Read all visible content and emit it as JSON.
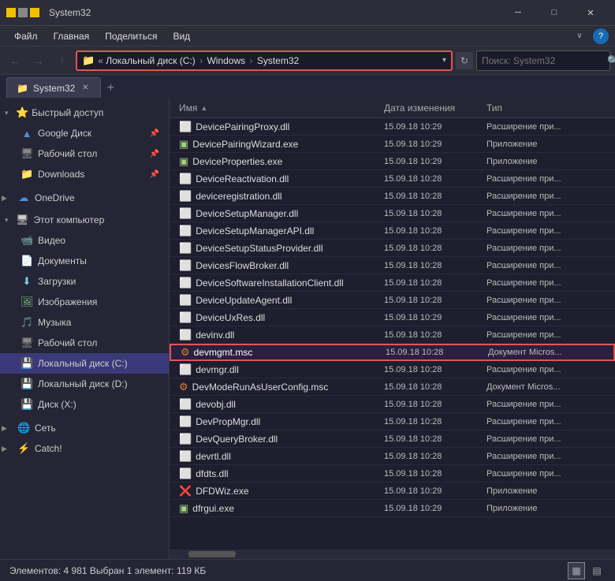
{
  "titleBar": {
    "title": "System32",
    "minimize": "─",
    "maximize": "□",
    "close": "✕"
  },
  "menuBar": {
    "items": [
      "Файл",
      "Главная",
      "Поделиться",
      "Вид"
    ]
  },
  "toolbar": {
    "backDisabled": true,
    "forwardDisabled": true,
    "upLabel": "↑",
    "addressIcon": "📁",
    "addressParts": [
      "« Локальный диск (C:)",
      "Windows",
      "System32"
    ],
    "refreshLabel": "↻",
    "searchPlaceholder": "Поиск: System32",
    "searchIcon": "🔍"
  },
  "tabs": {
    "items": [
      {
        "label": "System32",
        "icon": "📁"
      }
    ],
    "addLabel": "+"
  },
  "sidebar": {
    "quickAccess": {
      "label": "Быстрый доступ",
      "icon": "⭐",
      "items": [
        {
          "label": "Google Диск",
          "icon": "🔷",
          "pinned": true
        },
        {
          "label": "Рабочий стол",
          "icon": "🖥",
          "pinned": true
        },
        {
          "label": "Downloads",
          "icon": "📁",
          "pinned": true
        }
      ]
    },
    "onedrive": {
      "label": "OneDrive",
      "icon": "☁"
    },
    "thisPC": {
      "label": "Этот компьютер",
      "icon": "💻",
      "items": [
        {
          "label": "Видео",
          "icon": "🎬"
        },
        {
          "label": "Документы",
          "icon": "📄"
        },
        {
          "label": "Загрузки",
          "icon": "⬇"
        },
        {
          "label": "Изображения",
          "icon": "🖼"
        },
        {
          "label": "Музыка",
          "icon": "🎵"
        },
        {
          "label": "Рабочий стол",
          "icon": "🖥"
        }
      ]
    },
    "drives": [
      {
        "label": "Локальный диск (C:)",
        "icon": "💾",
        "selected": true
      },
      {
        "label": "Локальный диск (D:)",
        "icon": "💾"
      },
      {
        "label": "Диск (X:)",
        "icon": "💾"
      }
    ],
    "network": {
      "label": "Сеть",
      "icon": "🌐"
    },
    "catch": {
      "label": "Catch!",
      "icon": "⚡"
    }
  },
  "fileList": {
    "columns": {
      "name": "Имя",
      "date": "Дата изменения",
      "type": "Тип"
    },
    "files": [
      {
        "name": "DevicePairingProxy.dll",
        "icon": "dll",
        "date": "15.09.18 10:29",
        "type": "Расширение при..."
      },
      {
        "name": "DevicePairingWizard.exe",
        "icon": "exe",
        "date": "15.09.18 10:29",
        "type": "Приложение"
      },
      {
        "name": "DeviceProperties.exe",
        "icon": "exe",
        "date": "15.09.18 10:29",
        "type": "Приложение"
      },
      {
        "name": "DeviceReactivation.dll",
        "icon": "dll",
        "date": "15.09.18 10:28",
        "type": "Расширение при..."
      },
      {
        "name": "deviceregistration.dll",
        "icon": "dll",
        "date": "15.09.18 10:28",
        "type": "Расширение при..."
      },
      {
        "name": "DeviceSetupManager.dll",
        "icon": "dll",
        "date": "15.09.18 10:28",
        "type": "Расширение при..."
      },
      {
        "name": "DeviceSetupManagerAPI.dll",
        "icon": "dll",
        "date": "15.09.18 10:28",
        "type": "Расширение при..."
      },
      {
        "name": "DeviceSetupStatusProvider.dll",
        "icon": "dll",
        "date": "15.09.18 10:28",
        "type": "Расширение при..."
      },
      {
        "name": "DevicesFlowBroker.dll",
        "icon": "dll",
        "date": "15.09.18 10:28",
        "type": "Расширение при..."
      },
      {
        "name": "DeviceSoftwareInstallationClient.dll",
        "icon": "dll",
        "date": "15.09.18 10:28",
        "type": "Расширение при..."
      },
      {
        "name": "DeviceUpdateAgent.dll",
        "icon": "dll",
        "date": "15.09.18 10:28",
        "type": "Расширение при..."
      },
      {
        "name": "DeviceUxRes.dll",
        "icon": "dll",
        "date": "15.09.18 10:29",
        "type": "Расширение при..."
      },
      {
        "name": "devinv.dll",
        "icon": "dll",
        "date": "15.09.18 10:28",
        "type": "Расширение при..."
      },
      {
        "name": "devmgmt.msc",
        "icon": "msc",
        "date": "15.09.18 10:28",
        "type": "Документ Micros...",
        "selected": true
      },
      {
        "name": "devmgr.dll",
        "icon": "dll",
        "date": "15.09.18 10:28",
        "type": "Расширение при..."
      },
      {
        "name": "DevModeRunAsUserConfig.msc",
        "icon": "msc",
        "date": "15.09.18 10:28",
        "type": "Документ Micros..."
      },
      {
        "name": "devobj.dll",
        "icon": "dll",
        "date": "15.09.18 10:28",
        "type": "Расширение при..."
      },
      {
        "name": "DevPropMgr.dll",
        "icon": "dll",
        "date": "15.09.18 10:28",
        "type": "Расширение при..."
      },
      {
        "name": "DevQueryBroker.dll",
        "icon": "dll",
        "date": "15.09.18 10:28",
        "type": "Расширение при..."
      },
      {
        "name": "devrtl.dll",
        "icon": "dll",
        "date": "15.09.18 10:28",
        "type": "Расширение при..."
      },
      {
        "name": "dfdts.dll",
        "icon": "dll",
        "date": "15.09.18 10:28",
        "type": "Расширение при..."
      },
      {
        "name": "DFDWiz.exe",
        "icon": "exe_special",
        "date": "15.09.18 10:29",
        "type": "Приложение"
      },
      {
        "name": "dfrgui.exe",
        "icon": "exe",
        "date": "15.09.18 10:29",
        "type": "Приложение"
      }
    ]
  },
  "statusBar": {
    "info": "Элементов: 4 981   Выбран 1 элемент: 119 КБ",
    "viewGrid": "▦",
    "viewList": "▤"
  }
}
